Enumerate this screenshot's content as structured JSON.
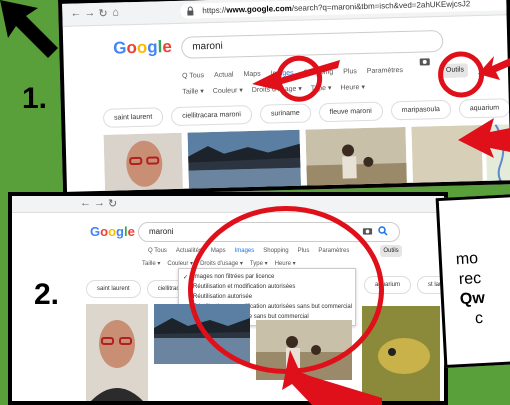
{
  "steps": [
    "1.",
    "2."
  ],
  "browser": {
    "nav_icons": [
      "arrow-left-icon",
      "arrow-right-icon",
      "reload-icon",
      "home-icon"
    ],
    "url_prefix": "https://",
    "url_host": "www.google.com",
    "url_path": "/search?q=maroni&tbm=isch&ved=2ahUKEwjcsJ2"
  },
  "google": {
    "logo": [
      "G",
      "o",
      "o",
      "g",
      "l",
      "e"
    ],
    "logo_colors": [
      "#4285f4",
      "#ea4335",
      "#fbbc05",
      "#4285f4",
      "#34a853",
      "#ea4335"
    ],
    "query": "maroni"
  },
  "panel1": {
    "tabs": [
      "Q Tous",
      "Actual",
      "Maps",
      "Images",
      "Shopping",
      "Plus",
      "Paramètres",
      "Outils"
    ],
    "filters": [
      "Taille ▾",
      "Couleur ▾",
      "Droits d'usage ▾",
      "Type ▾",
      "Heure ▾"
    ],
    "chips": [
      "saint laurent",
      "ciellitracara maroni",
      "suriname",
      "fleuve maroni",
      "maripasoula",
      "aquarium"
    ]
  },
  "panel2": {
    "tabs": [
      "Q Tous",
      "Actualités",
      "Maps",
      "Images",
      "Shopping",
      "Plus",
      "Paramètres",
      "Outils"
    ],
    "filters": [
      "Taille ▾",
      "Couleur ▾",
      "Droits d'usage ▾",
      "Type ▾",
      "Heure ▾"
    ],
    "chips": [
      "saint laurent",
      "ciellitracara maroni",
      "aquarium",
      "st laure"
    ],
    "menu": [
      "Images non filtrées par licence",
      "Réutilisation et modification autorisées",
      "Réutilisation autorisée",
      "Réutilisation et modification autorisées sans but commercial",
      "Réutilisation autorisée sans but commercial"
    ]
  },
  "side_panel": {
    "lines": [
      "mo",
      "rec",
      "Qw",
      "c"
    ]
  },
  "colors": {
    "background": "#59a03a",
    "annotation_red": "#e0101a",
    "google_blue": "#1a73e8"
  }
}
